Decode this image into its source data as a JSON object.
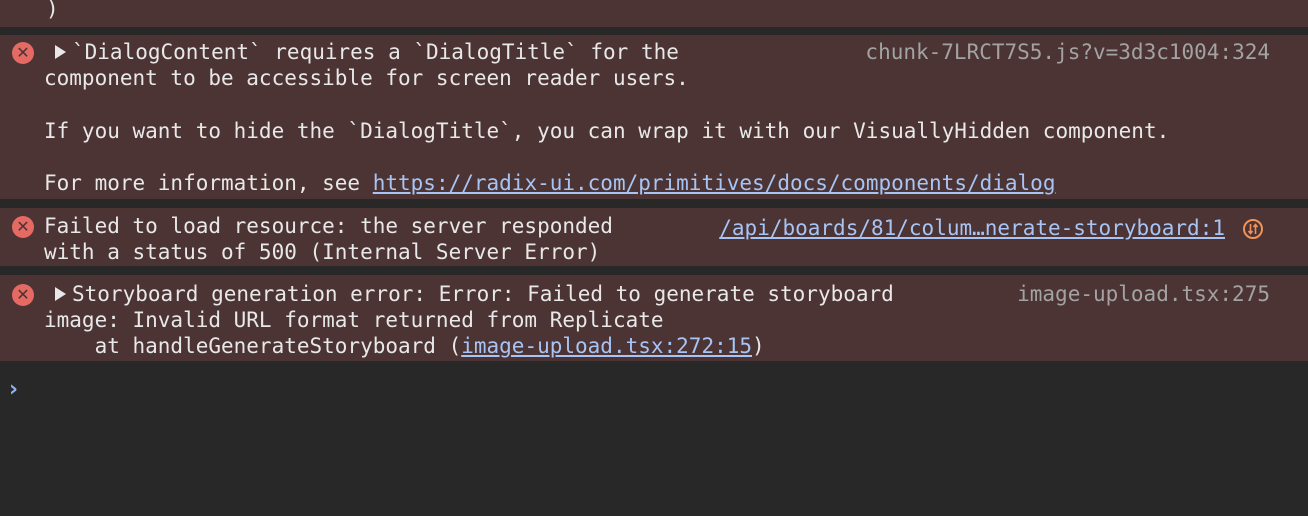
{
  "prev_message": {
    "tail": ")"
  },
  "msg_dialog": {
    "line1": "`DialogContent` requires a `DialogTitle` for the",
    "line2": "component to be accessible for screen reader users.",
    "line3": "If you want to hide the `DialogTitle`, you can wrap it with our VisuallyHidden component.",
    "line4_prefix": "For more information, see ",
    "link": "https://radix-ui.com/primitives/docs/components/dialog",
    "source": "chunk-7LRCT7S5.js?v=3d3c1004:324"
  },
  "msg_resource": {
    "line1": "Failed to load resource: the server responded",
    "line2": "with a status of 500 (Internal Server Error)",
    "source": "/api/boards/81/colum…nerate-storyboard:1"
  },
  "msg_storyboard": {
    "line1": "Storyboard generation error: Error: Failed to generate storyboard",
    "line2": "image: Invalid URL format returned from Replicate",
    "line3_prefix": "    at handleGenerateStoryboard (",
    "line3_link": "image-upload.tsx:272:15",
    "line3_suffix": ")",
    "source": "image-upload.tsx:275"
  },
  "prompt": {
    "symbol": "›"
  },
  "colors": {
    "background": "#282828",
    "error_background": "#4b3433",
    "error_icon": "#e46a63",
    "link": "#a8c4f5",
    "network_icon": "#f0935a"
  },
  "icons": {
    "error": "error-x-icon",
    "expand": "disclosure-triangle-icon",
    "network": "network-request-icon"
  }
}
